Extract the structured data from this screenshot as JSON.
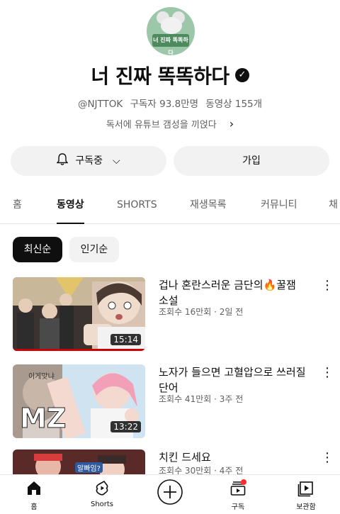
{
  "channel": {
    "avatar_text": "너 진짜 똑똑하다",
    "title": "너 진짜 똑똑하다",
    "verified_icon": "verified-check-icon",
    "handle": "@NJTTOK",
    "subscribers": "구독자 93.8만명",
    "video_count": "동영상 155개",
    "description": "독서에 유튜브 갬성을 끼얹다"
  },
  "actions": {
    "subscribe_label": "구독중",
    "join_label": "가입"
  },
  "tabs": [
    {
      "label": "홈",
      "active": false
    },
    {
      "label": "동영상",
      "active": true
    },
    {
      "label": "SHORTS",
      "active": false
    },
    {
      "label": "재생목록",
      "active": false
    },
    {
      "label": "커뮤니티",
      "active": false
    },
    {
      "label": "채",
      "active": false
    }
  ],
  "sort_chips": [
    {
      "label": "최신순",
      "selected": true
    },
    {
      "label": "인기순",
      "selected": false
    }
  ],
  "videos": [
    {
      "title": "겁나 혼란스러운 금단의🔥꿀잼 소설",
      "views": "조회수 16만회",
      "age": "2일 전",
      "duration": "15:14"
    },
    {
      "title": "노자가 들으면 고혈압으로 쓰러질 단어",
      "views": "조회수 41만회",
      "age": "3주 전",
      "duration": "13:22",
      "thumb_text": "MZ",
      "thumb_bubble": "이게맞냐"
    },
    {
      "title": "치킨 드세요",
      "views": "조회수 30만회",
      "age": "4주 전",
      "thumb_bubble": "알빠임?"
    }
  ],
  "bottom_nav": [
    {
      "label": "홈",
      "icon": "home-icon"
    },
    {
      "label": "Shorts",
      "icon": "shorts-icon"
    },
    {
      "label": "",
      "icon": "create-plus-icon"
    },
    {
      "label": "구독",
      "icon": "subscriptions-icon"
    },
    {
      "label": "보관함",
      "icon": "library-icon"
    }
  ],
  "colors": {
    "accent_red": "#cc0000",
    "text_primary": "#0f0f0f",
    "text_secondary": "#606060",
    "chip_bg": "#f2f2f2"
  }
}
